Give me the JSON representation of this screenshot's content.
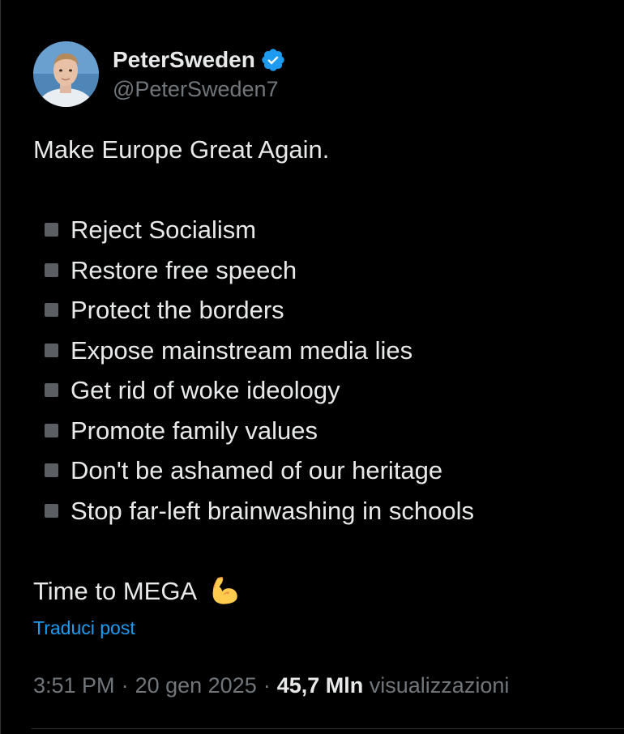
{
  "author": {
    "display_name": "PeterSweden",
    "handle": "@PeterSweden7",
    "verified": true,
    "avatar_icon": "profile-photo",
    "verified_icon": "verified-badge-icon",
    "verified_color": "#1d9bf0"
  },
  "tweet": {
    "intro": "Make Europe Great Again.",
    "bullet_icon": "black-square-emoji",
    "items": [
      "Reject Socialism",
      "Restore free speech",
      "Protect the borders",
      "Expose mainstream media lies",
      "Get rid of woke ideology",
      "Promote family values",
      "Don't be ashamed of our heritage",
      "Stop far-left brainwashing in schools"
    ],
    "outro": "Time to MEGA",
    "outro_emoji": "flexed-biceps-emoji"
  },
  "translate_label": "Traduci post",
  "meta": {
    "time": "3:51 PM",
    "separator": "·",
    "date": "20 gen 2025",
    "views_count": "45,7 Mln",
    "views_label": "visualizzazioni"
  },
  "colors": {
    "background": "#000000",
    "text_primary": "#e7e9ea",
    "text_secondary": "#71767b",
    "link": "#1d9bf0",
    "divider": "#2f3336"
  }
}
